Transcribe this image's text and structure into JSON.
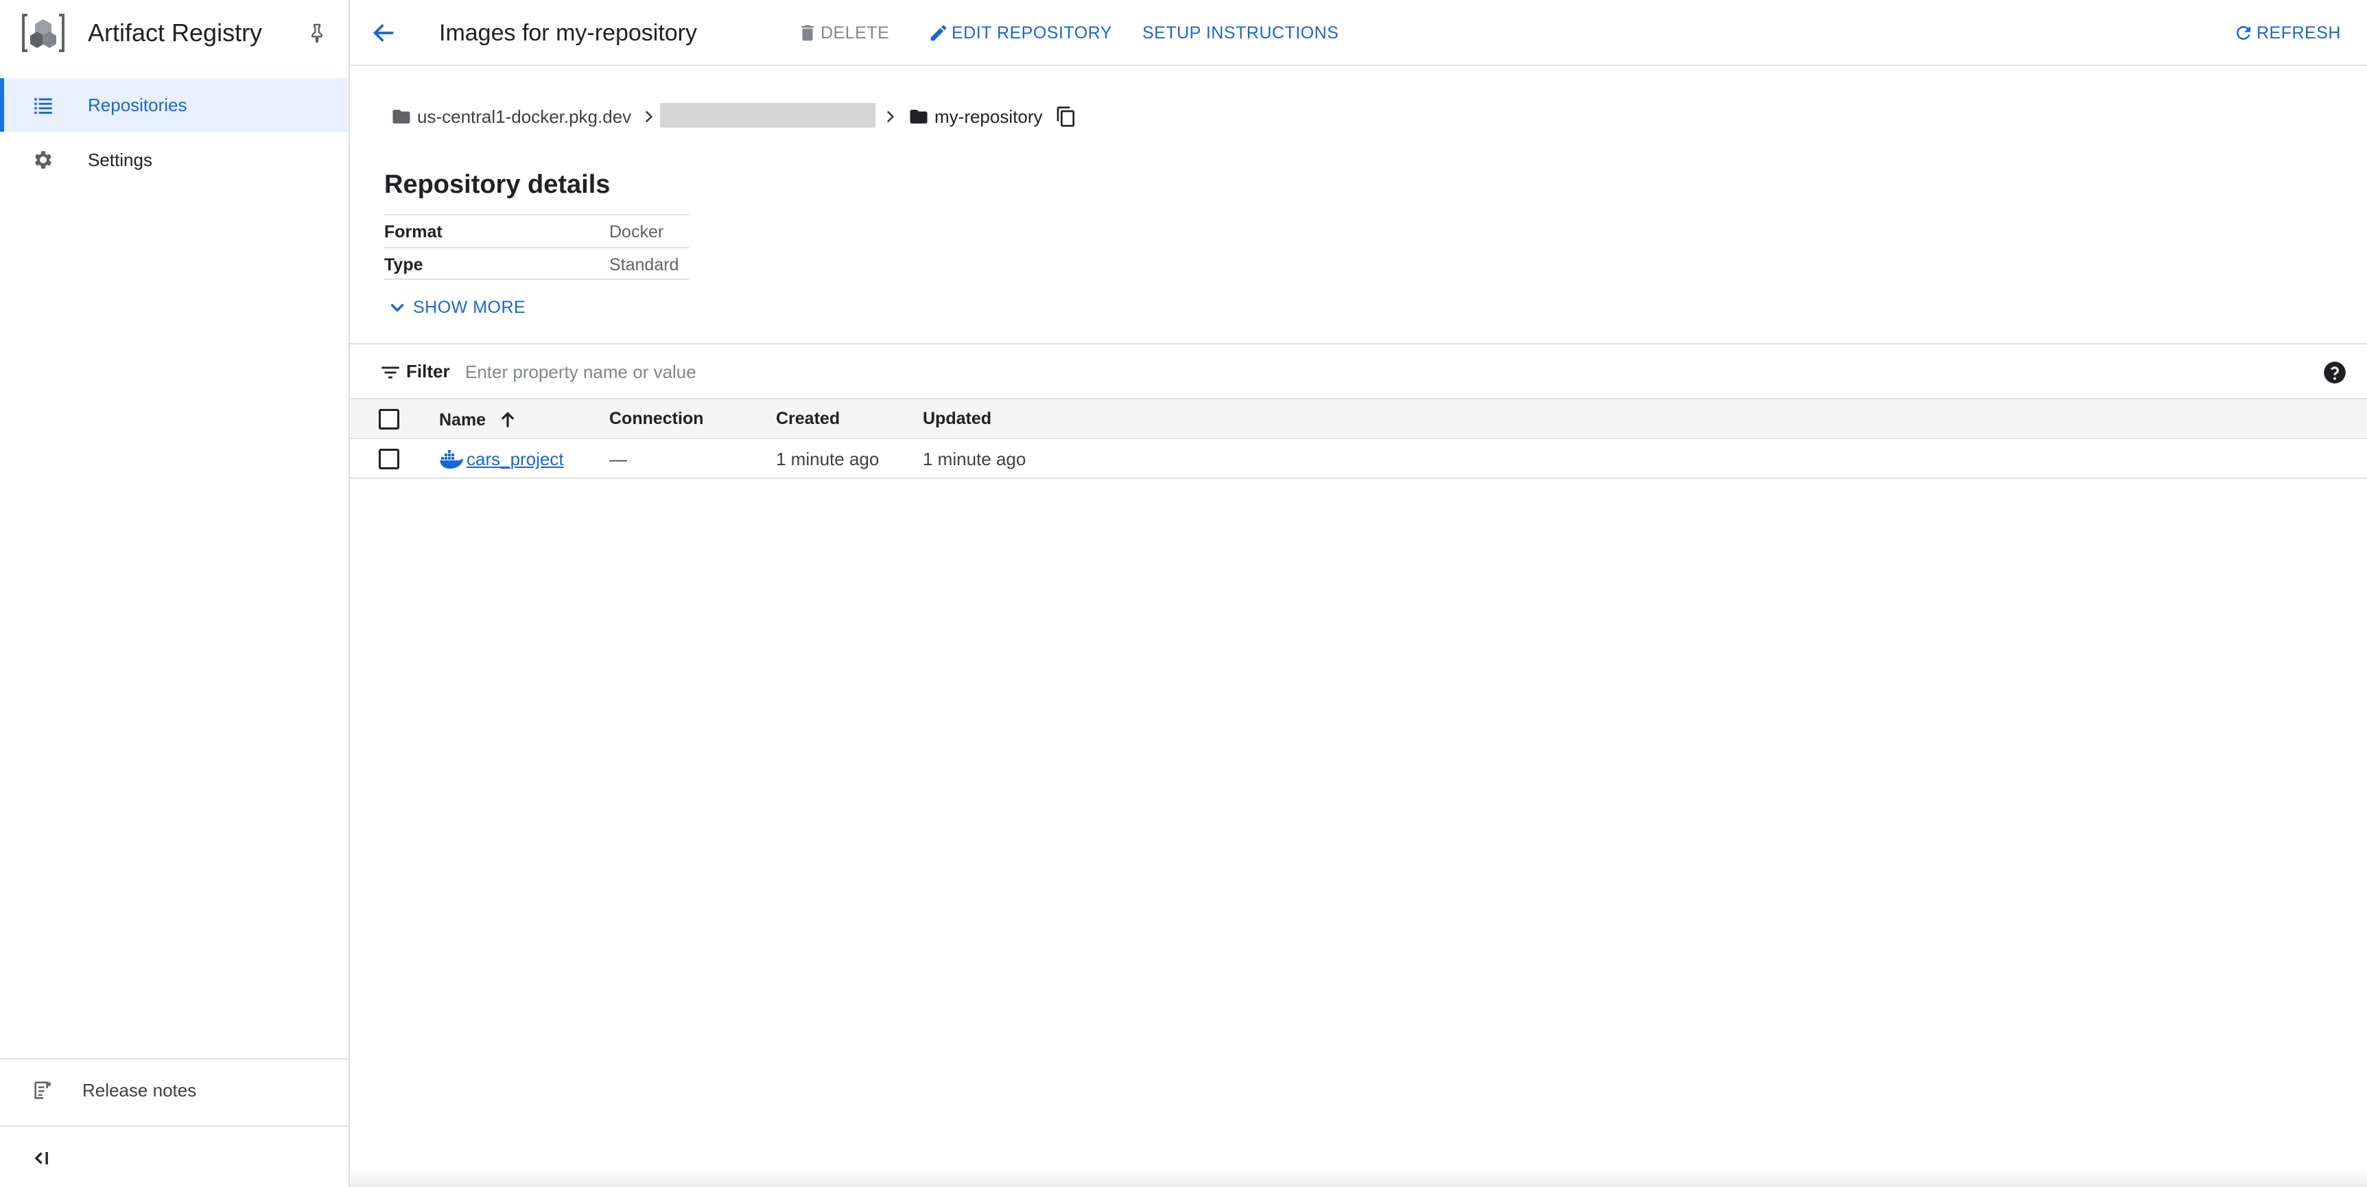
{
  "sidebar": {
    "title": "Artifact Registry",
    "items": [
      {
        "label": "Repositories",
        "active": true
      },
      {
        "label": "Settings",
        "active": false
      }
    ],
    "release_notes": "Release notes"
  },
  "topbar": {
    "page_title": "Images for my-repository",
    "delete_label": "DELETE",
    "edit_label": "EDIT REPOSITORY",
    "setup_label": "SETUP INSTRUCTIONS",
    "refresh_label": "REFRESH"
  },
  "breadcrumb": {
    "host": "us-central1-docker.pkg.dev",
    "repository": "my-repository"
  },
  "details": {
    "title": "Repository details",
    "rows": [
      {
        "key": "Format",
        "value": "Docker"
      },
      {
        "key": "Type",
        "value": "Standard"
      }
    ],
    "show_more": "SHOW MORE"
  },
  "filter": {
    "label": "Filter",
    "placeholder": "Enter property name or value"
  },
  "table": {
    "columns": [
      "Name",
      "Connection",
      "Created",
      "Updated"
    ],
    "rows": [
      {
        "name": "cars_project",
        "connection": "—",
        "created": "1 minute ago",
        "updated": "1 minute ago"
      }
    ]
  },
  "colors": {
    "accent": "#1967d2",
    "active_bg": "#e8f0fe",
    "border": "#e0e0e0"
  }
}
